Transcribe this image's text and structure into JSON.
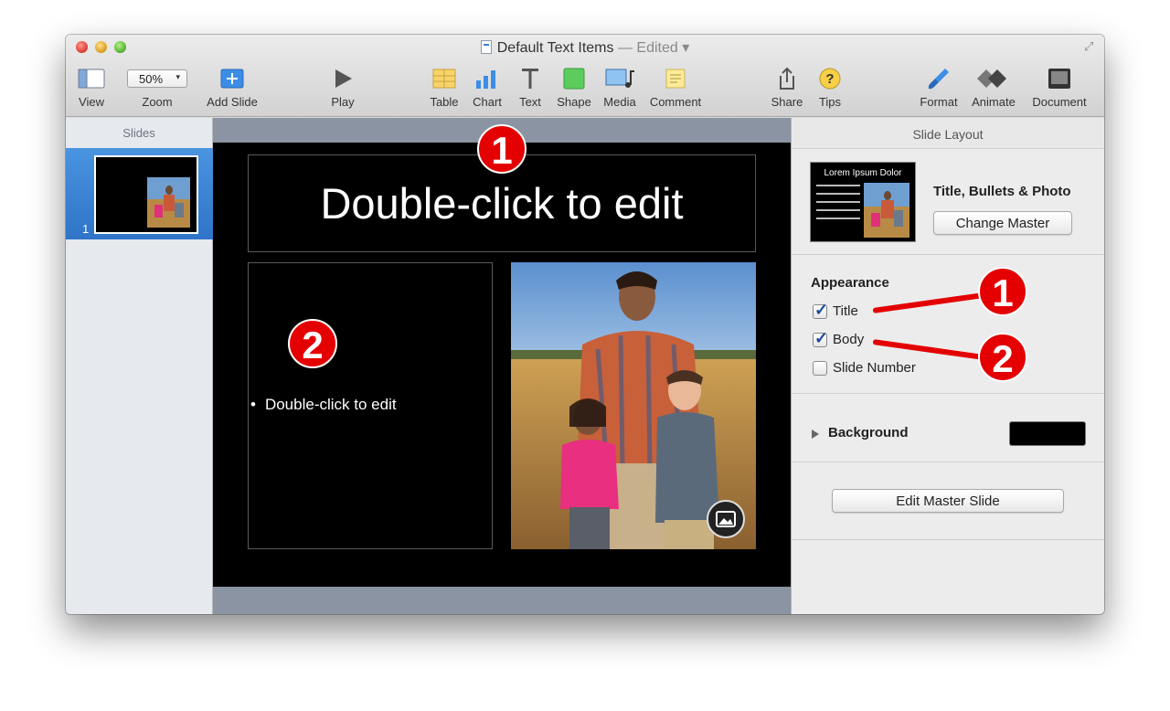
{
  "window": {
    "title": "Default Text Items",
    "edited": "— Edited"
  },
  "toolbar": {
    "view": "View",
    "zoom_value": "50%",
    "zoom": "Zoom",
    "add_slide": "Add Slide",
    "play": "Play",
    "table": "Table",
    "chart": "Chart",
    "text": "Text",
    "shape": "Shape",
    "media": "Media",
    "comment": "Comment",
    "share": "Share",
    "tips": "Tips",
    "format": "Format",
    "animate": "Animate",
    "document": "Document"
  },
  "sidebar": {
    "header": "Slides",
    "slides": [
      {
        "number": "1"
      }
    ]
  },
  "slide": {
    "title_placeholder": "Double-click to edit",
    "body_placeholder": "Double-click to edit",
    "bullet": "•"
  },
  "inspector": {
    "header": "Slide Layout",
    "layout_name": "Title, Bullets & Photo",
    "master_thumb_title": "Lorem Ipsum Dolor",
    "change_master": "Change Master",
    "appearance": "Appearance",
    "options": [
      {
        "label": "Title",
        "checked": true
      },
      {
        "label": "Body",
        "checked": true
      },
      {
        "label": "Slide Number",
        "checked": false
      }
    ],
    "background": "Background",
    "background_color": "#000000",
    "edit_master": "Edit Master Slide"
  },
  "annotations": [
    "1",
    "2",
    "1",
    "2"
  ],
  "colors": {
    "accent_blue": "#2f74c8",
    "annotation_red": "#e40000"
  }
}
